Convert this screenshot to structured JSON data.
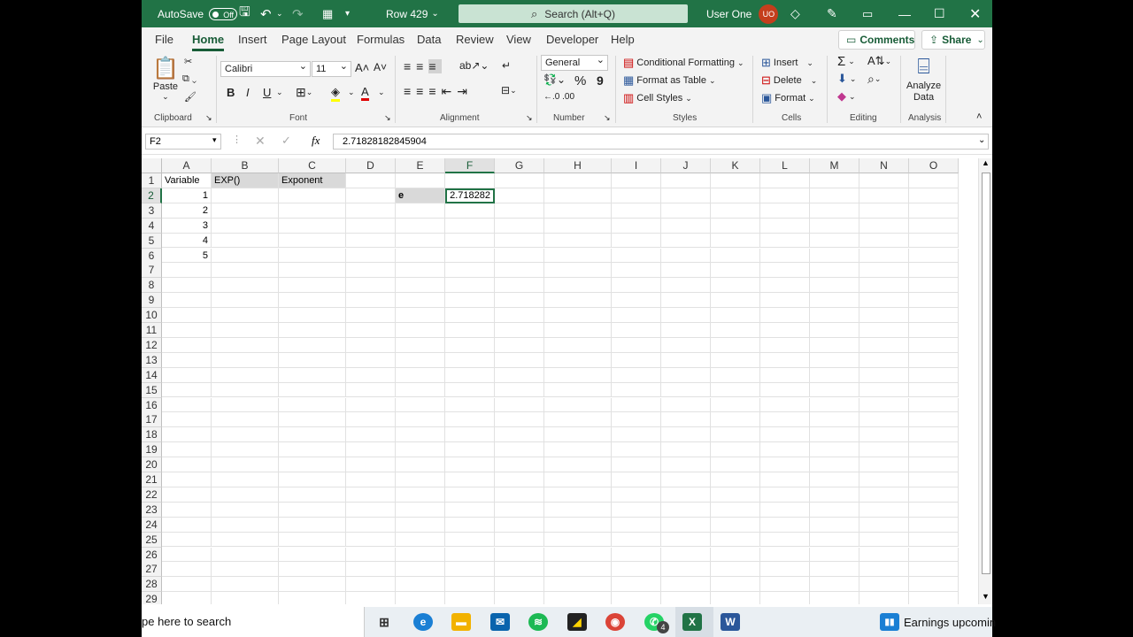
{
  "titlebar": {
    "autosave_label": "AutoSave",
    "autosave_state": "Off",
    "doc_title": "Row 429",
    "search_placeholder": "Search (Alt+Q)",
    "user_name": "User One",
    "user_initials": "UO"
  },
  "menu": {
    "tabs": [
      "File",
      "Home",
      "Insert",
      "Page Layout",
      "Formulas",
      "Data",
      "Review",
      "View",
      "Developer",
      "Help"
    ],
    "active_tab": "Home",
    "comments_label": "Comments",
    "share_label": "Share"
  },
  "ribbon": {
    "clipboard": {
      "paste": "Paste",
      "label": "Clipboard"
    },
    "font": {
      "name": "Calibri",
      "size": "11",
      "bold": "B",
      "italic": "I",
      "underline": "U",
      "label": "Font"
    },
    "alignment": {
      "label": "Alignment"
    },
    "number": {
      "format": "General",
      "percent": "%",
      "comma": "9",
      "label": "Number"
    },
    "styles": {
      "conditional": "Conditional Formatting",
      "table": "Format as Table",
      "cell_styles": "Cell Styles",
      "label": "Styles"
    },
    "cells": {
      "insert": "Insert",
      "delete": "Delete",
      "format": "Format",
      "label": "Cells"
    },
    "editing": {
      "label": "Editing"
    },
    "analysis": {
      "analyze_line1": "Analyze",
      "analyze_line2": "Data",
      "label": "Analysis"
    }
  },
  "formula_bar": {
    "name_box": "F2",
    "fx": "fx",
    "content": "2.71828182845904"
  },
  "sheet": {
    "columns": [
      "A",
      "B",
      "C",
      "D",
      "E",
      "F",
      "G",
      "H",
      "I",
      "J",
      "K",
      "L",
      "M",
      "N",
      "O"
    ],
    "rows": [
      "1",
      "2",
      "3",
      "4",
      "5",
      "6",
      "7",
      "8",
      "9",
      "10",
      "11",
      "12",
      "13",
      "14",
      "15",
      "16",
      "17",
      "18",
      "19",
      "20",
      "21",
      "22",
      "23",
      "24",
      "25",
      "26",
      "27",
      "28",
      "29"
    ],
    "A1": "Variable",
    "B1": "EXP()",
    "C1": "Exponent",
    "A2": "1",
    "A3": "2",
    "A4": "3",
    "A5": "4",
    "A6": "5",
    "E2": "e",
    "F2": "2.718282"
  },
  "taskbar": {
    "search_text": "pe here to search",
    "whatsapp_badge": "4",
    "news_text": "Earnings upcomin"
  },
  "colors": {
    "excel_green": "#217346",
    "shade": "#d9d9d9"
  }
}
